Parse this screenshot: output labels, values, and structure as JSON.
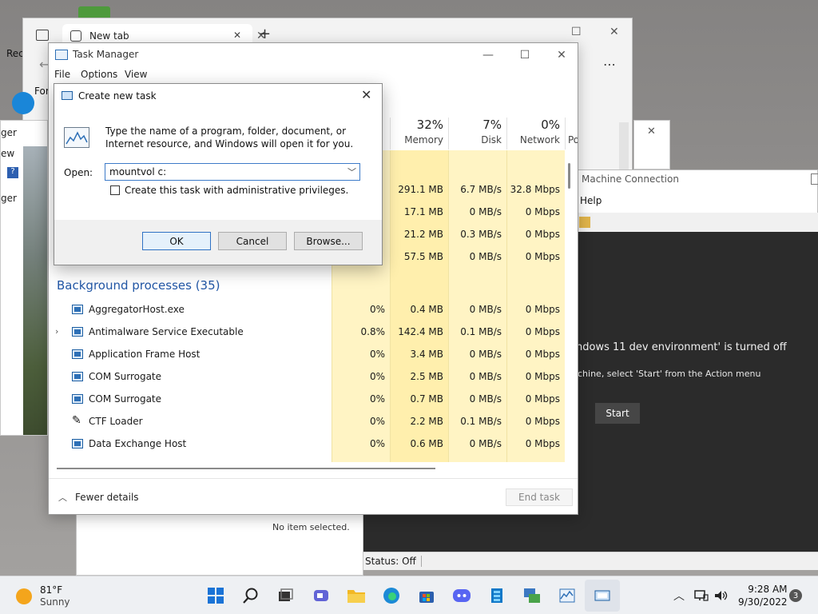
{
  "desktop": {
    "icon_label_fragment": "Rec"
  },
  "browser": {
    "tab_title": "New tab",
    "sidebar_label_fragment": "For"
  },
  "explorer": {
    "label_fragment_1": "ger",
    "label_fragment_2": "ew",
    "label_fragment_3": "ger"
  },
  "vm_connection": {
    "title_fragment": "Machine Connection",
    "menu_help": "Help",
    "message_1": "ndows 11 dev environment' is turned off",
    "message_2": "chine, select 'Start' from the Action menu",
    "start_label": "Start",
    "status": "Status: Off"
  },
  "lower_window": {
    "status_text": "No item selected."
  },
  "task_manager": {
    "title": "Task Manager",
    "menu": [
      "File",
      "Options",
      "View"
    ],
    "columns": {
      "memory": {
        "pct": "32%",
        "label": "Memory"
      },
      "disk": {
        "pct": "7%",
        "label": "Disk"
      },
      "network": {
        "pct": "0%",
        "label": "Network"
      },
      "power_fragment": "Po"
    },
    "app_rows": [
      {
        "memory": "291.1 MB",
        "disk": "6.7 MB/s",
        "network": "32.8 Mbps"
      },
      {
        "memory": "17.1 MB",
        "disk": "0 MB/s",
        "network": "0 Mbps"
      },
      {
        "memory": "21.2 MB",
        "disk": "0.3 MB/s",
        "network": "0 Mbps"
      },
      {
        "memory": "57.5 MB",
        "disk": "0 MB/s",
        "network": "0 Mbps"
      }
    ],
    "background_heading": "Background processes (35)",
    "processes": [
      {
        "name": "AggregatorHost.exe",
        "cpu": "0%",
        "memory": "0.4 MB",
        "disk": "0 MB/s",
        "network": "0 Mbps"
      },
      {
        "name": "Antimalware Service Executable",
        "cpu": "0.8%",
        "memory": "142.4 MB",
        "disk": "0.1 MB/s",
        "network": "0 Mbps"
      },
      {
        "name": "Application Frame Host",
        "cpu": "0%",
        "memory": "3.4 MB",
        "disk": "0 MB/s",
        "network": "0 Mbps"
      },
      {
        "name": "COM Surrogate",
        "cpu": "0%",
        "memory": "2.5 MB",
        "disk": "0 MB/s",
        "network": "0 Mbps"
      },
      {
        "name": "COM Surrogate",
        "cpu": "0%",
        "memory": "0.7 MB",
        "disk": "0 MB/s",
        "network": "0 Mbps"
      },
      {
        "name": "CTF Loader",
        "cpu": "0%",
        "memory": "2.2 MB",
        "disk": "0.1 MB/s",
        "network": "0 Mbps"
      },
      {
        "name": "Data Exchange Host",
        "cpu": "0%",
        "memory": "0.6 MB",
        "disk": "0 MB/s",
        "network": "0 Mbps"
      }
    ],
    "fewer_details": "Fewer details",
    "end_task": "End task"
  },
  "run_dialog": {
    "title": "Create new task",
    "description": "Type the name of a program, folder, document, or Internet resource, and Windows will open it for you.",
    "open_label": "Open:",
    "open_value": "mountvol c:",
    "admin_label": "Create this task with administrative privileges.",
    "ok": "OK",
    "cancel": "Cancel",
    "browse": "Browse..."
  },
  "taskbar": {
    "weather_temp": "81°F",
    "weather_desc": "Sunny",
    "time": "9:28 AM",
    "date": "9/30/2022",
    "notification_count": "3"
  }
}
